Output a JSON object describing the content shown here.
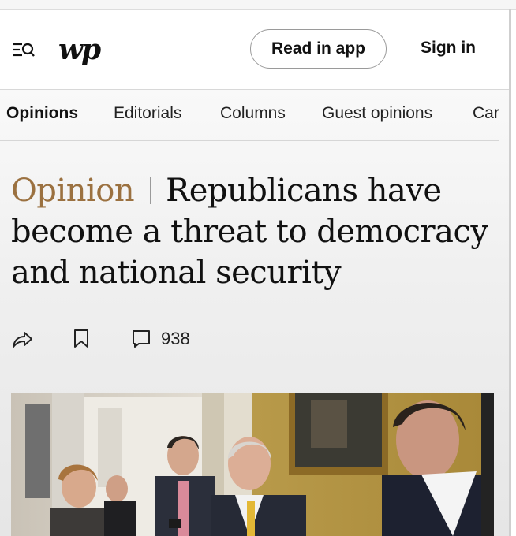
{
  "header": {
    "menu_icon": "menu-search-icon",
    "logo_text": "wp",
    "read_in_app_label": "Read in app",
    "sign_in_label": "Sign in"
  },
  "subnav": {
    "items": [
      {
        "label": "Opinions",
        "active": true
      },
      {
        "label": "Editorials",
        "active": false
      },
      {
        "label": "Columns",
        "active": false
      },
      {
        "label": "Guest opinions",
        "active": false
      },
      {
        "label": "Car",
        "active": false
      }
    ]
  },
  "article": {
    "kicker": "Opinion",
    "title": "Republicans have become a threat to democracy and national security",
    "actions": {
      "share_icon": "share-icon",
      "bookmark_icon": "bookmark-icon",
      "comment_icon": "comment-icon",
      "comment_count": "938"
    },
    "photo": "photo of a group of men in suits in a hallway with a framed painting on a yellow wall"
  },
  "colors": {
    "kicker": "#9b7140",
    "text": "#111111",
    "divider": "#d6d6d6"
  }
}
